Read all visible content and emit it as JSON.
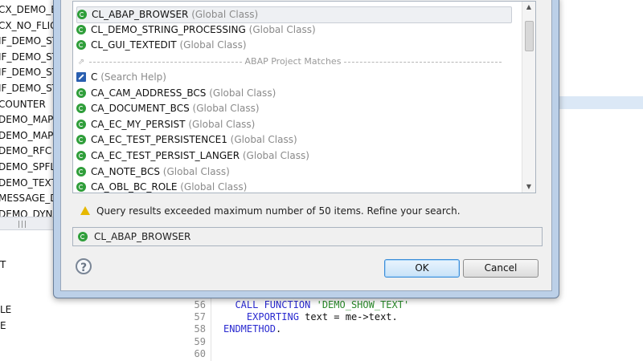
{
  "background": {
    "tree_items": [
      "CX_DEMO_E",
      "CX_NO_FLIG",
      "IF_DEMO_ST",
      "IF_DEMO_ST",
      "IF_DEMO_ST",
      "IF_DEMO_ST",
      "COUNTER",
      "DEMO_MAP",
      "DEMO_MAP",
      "DEMO_RFC",
      "DEMO_SPFLI",
      "DEMO_TEXT",
      "MESSAGE_D",
      "DEMO_DYN"
    ],
    "scroll_grip": "|||",
    "lower_items": [
      "T",
      "LE",
      "E"
    ]
  },
  "code": {
    "lines": [
      {
        "num": "56",
        "indent": "  ",
        "kw": "CALL FUNCTION",
        "str": " 'DEMO_SHOW_TEXT'",
        "rest": ""
      },
      {
        "num": "57",
        "indent": "    ",
        "kw": "EXPORTING",
        "str": "",
        "rest": " text = me->text."
      },
      {
        "num": "58",
        "indent": "",
        "kw": "ENDMETHOD",
        "str": "",
        "rest": "."
      },
      {
        "num": "59",
        "indent": "",
        "kw": "",
        "str": "",
        "rest": ""
      },
      {
        "num": "60",
        "indent": "",
        "kw": "",
        "str": "",
        "rest": ""
      }
    ]
  },
  "dialog": {
    "results": [
      {
        "name": "CL_ABAP_BROWSER",
        "type": "(Global Class)",
        "icon": "class-icon",
        "selected": true
      },
      {
        "name": "CL_DEMO_STRING_PROCESSING",
        "type": "(Global Class)",
        "icon": "class-icon"
      },
      {
        "name": "CL_GUI_TEXTEDIT",
        "type": "(Global Class)",
        "icon": "class-icon"
      }
    ],
    "separator_label": "ABAP Project Matches",
    "project_matches": [
      {
        "name": "C",
        "type": "(Search Help)",
        "icon": "search-help-icon"
      },
      {
        "name": "CA_CAM_ADDRESS_BCS",
        "type": "(Global Class)",
        "icon": "class-icon"
      },
      {
        "name": "CA_DOCUMENT_BCS",
        "type": "(Global Class)",
        "icon": "class-icon"
      },
      {
        "name": "CA_EC_MY_PERSIST",
        "type": "(Global Class)",
        "icon": "class-icon"
      },
      {
        "name": "CA_EC_TEST_PERSISTENCE1",
        "type": "(Global Class)",
        "icon": "class-icon"
      },
      {
        "name": "CA_EC_TEST_PERSIST_LANGER",
        "type": "(Global Class)",
        "icon": "class-icon"
      },
      {
        "name": "CA_NOTE_BCS",
        "type": "(Global Class)",
        "icon": "class-icon"
      },
      {
        "name": "CA_OBL_BC_ROLE",
        "type": "(Global Class)",
        "icon": "class-icon"
      }
    ],
    "warning": "Query results exceeded maximum number of 50 items. Refine your search.",
    "selected_value": "CL_ABAP_BROWSER",
    "help_label": "?",
    "ok_label": "OK",
    "cancel_label": "Cancel"
  },
  "colors": {
    "class_icon": "#2f9e3a",
    "search_help_icon": "#2a5fb0",
    "warning_icon": "#e6b800",
    "dialog_frame": "#bcd0e8"
  }
}
